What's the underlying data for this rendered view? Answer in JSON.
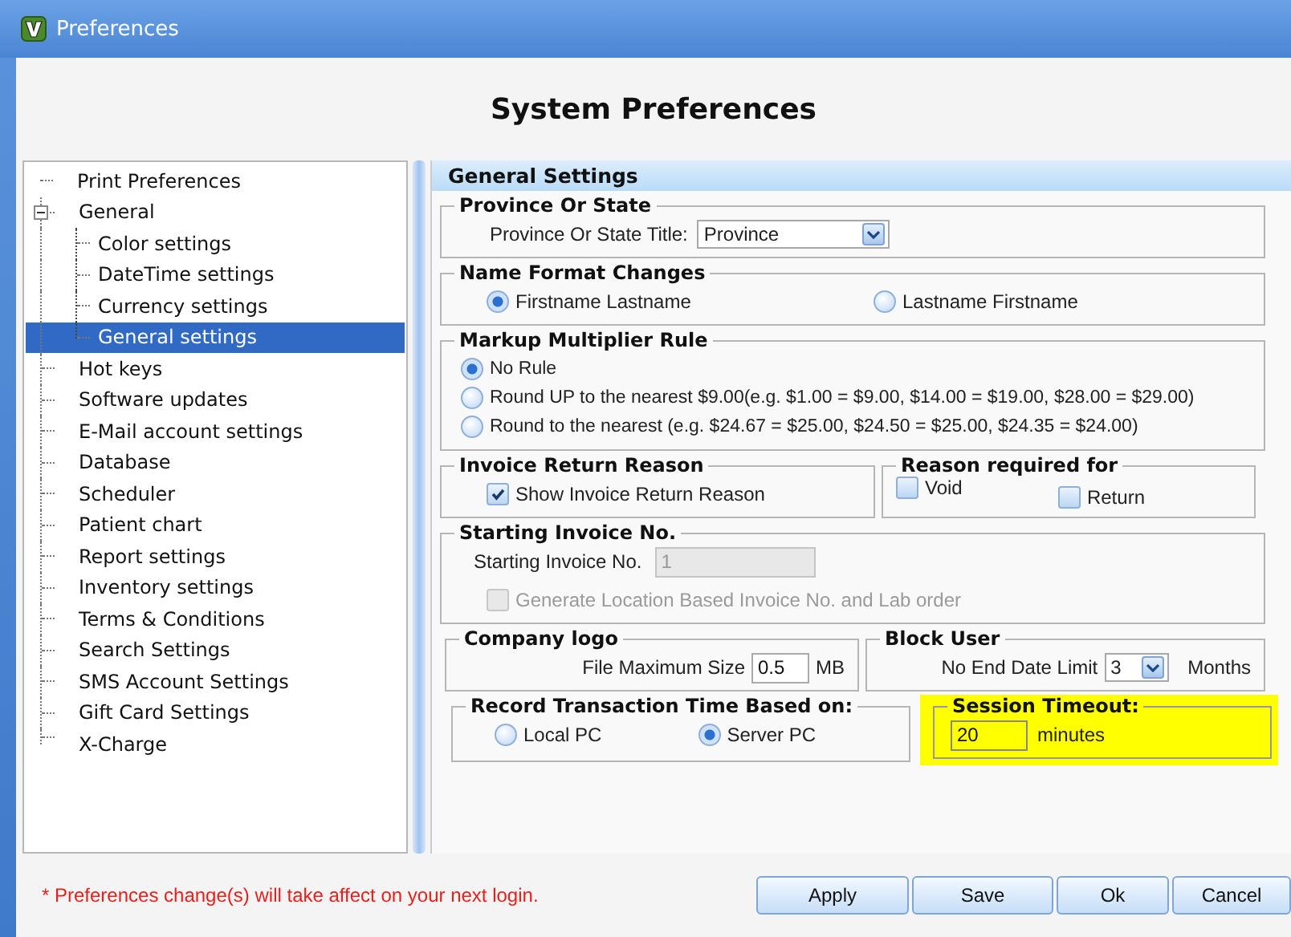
{
  "window": {
    "title": "Preferences"
  },
  "heading": "System Preferences",
  "tree": [
    {
      "label": "Print Preferences",
      "selected": false
    },
    {
      "label": "General",
      "selected": false,
      "expanded": true,
      "children": [
        {
          "label": "Color settings",
          "selected": false
        },
        {
          "label": "DateTime settings",
          "selected": false
        },
        {
          "label": "Currency settings",
          "selected": false
        },
        {
          "label": "General settings",
          "selected": true
        }
      ]
    },
    {
      "label": "Hot keys",
      "selected": false
    },
    {
      "label": "Software updates",
      "selected": false
    },
    {
      "label": "E-Mail account settings",
      "selected": false
    },
    {
      "label": "Database",
      "selected": false
    },
    {
      "label": "Scheduler",
      "selected": false
    },
    {
      "label": "Patient chart",
      "selected": false
    },
    {
      "label": "Report settings",
      "selected": false
    },
    {
      "label": "Inventory settings",
      "selected": false
    },
    {
      "label": "Terms & Conditions",
      "selected": false
    },
    {
      "label": "Search Settings",
      "selected": false
    },
    {
      "label": "SMS Account Settings",
      "selected": false
    },
    {
      "label": "Gift Card Settings",
      "selected": false
    },
    {
      "label": "X-Charge",
      "selected": false
    }
  ],
  "panel": {
    "title": "General Settings",
    "province": {
      "legend": "Province Or State",
      "label": "Province Or State Title:",
      "value": "Province"
    },
    "name_format": {
      "legend": "Name Format Changes",
      "options": [
        {
          "label": "Firstname Lastname",
          "selected": true
        },
        {
          "label": "Lastname Firstname",
          "selected": false
        }
      ]
    },
    "markup": {
      "legend": "Markup Multiplier Rule",
      "options": [
        {
          "label": "No Rule",
          "selected": true
        },
        {
          "label": "Round UP to the nearest $9.00(e.g. $1.00 = $9.00, $14.00 = $19.00, $28.00 = $29.00)",
          "selected": false
        },
        {
          "label": "Round to the nearest (e.g. $24.67 = $25.00, $24.50 = $25.00, $24.35 = $24.00)",
          "selected": false
        }
      ]
    },
    "invoice_return": {
      "legend": "Invoice Return Reason",
      "checkbox": {
        "label": "Show Invoice Return Reason",
        "checked": true
      }
    },
    "reason_required": {
      "legend": "Reason required for",
      "checkboxes": [
        {
          "label": "Void",
          "checked": false
        },
        {
          "label": "Return",
          "checked": false
        }
      ]
    },
    "starting_invoice": {
      "legend": "Starting Invoice No.",
      "label": "Starting Invoice No.",
      "value": "1",
      "disabled": true,
      "checkbox": {
        "label": "Generate Location Based Invoice No. and Lab order",
        "checked": false,
        "disabled": true
      }
    },
    "company_logo": {
      "legend": "Company logo",
      "label": "File Maximum Size",
      "value": "0.5",
      "unit": "MB"
    },
    "block_user": {
      "legend": "Block User",
      "label": "No End Date Limit",
      "value": "3",
      "unit": "Months"
    },
    "record_time": {
      "legend": "Record Transaction Time Based on:",
      "options": [
        {
          "label": "Local PC",
          "selected": false
        },
        {
          "label": "Server PC",
          "selected": true
        }
      ]
    },
    "session_timeout": {
      "legend": "Session Timeout:",
      "value": "20",
      "unit": "minutes",
      "highlighted": true
    }
  },
  "footer": {
    "note": "* Preferences change(s) will take affect on your next login.",
    "buttons": [
      "Apply",
      "Save",
      "Ok",
      "Cancel"
    ]
  }
}
